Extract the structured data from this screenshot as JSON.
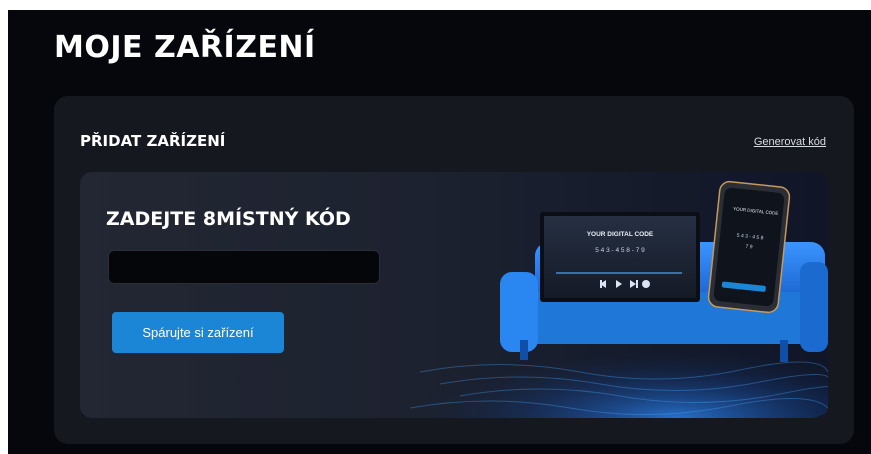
{
  "page": {
    "title": "MOJE ZAŘÍZENÍ"
  },
  "card": {
    "title": "PŘIDAT ZAŘÍZENÍ",
    "generate_link": "Generovat kód"
  },
  "pair_panel": {
    "heading": "ZADEJTE 8MÍSTNÝ KÓD",
    "code_input": {
      "value": "",
      "placeholder": ""
    },
    "pair_button": "Spárujte si zařízení"
  },
  "illustration": {
    "tv_heading": "YOUR DIGITAL CODE",
    "tv_code": "5 4 3 - 4 5 8 - 7 9",
    "phone_heading": "YOUR DIGITAL CODE",
    "phone_code": "5 4 3 - 4 5 8",
    "phone_code_line2": "7 9"
  },
  "colors": {
    "page_bg": "#05070c",
    "card_bg": "#15181f",
    "button": "#1b86d6",
    "sofa": "#1f78d8"
  }
}
